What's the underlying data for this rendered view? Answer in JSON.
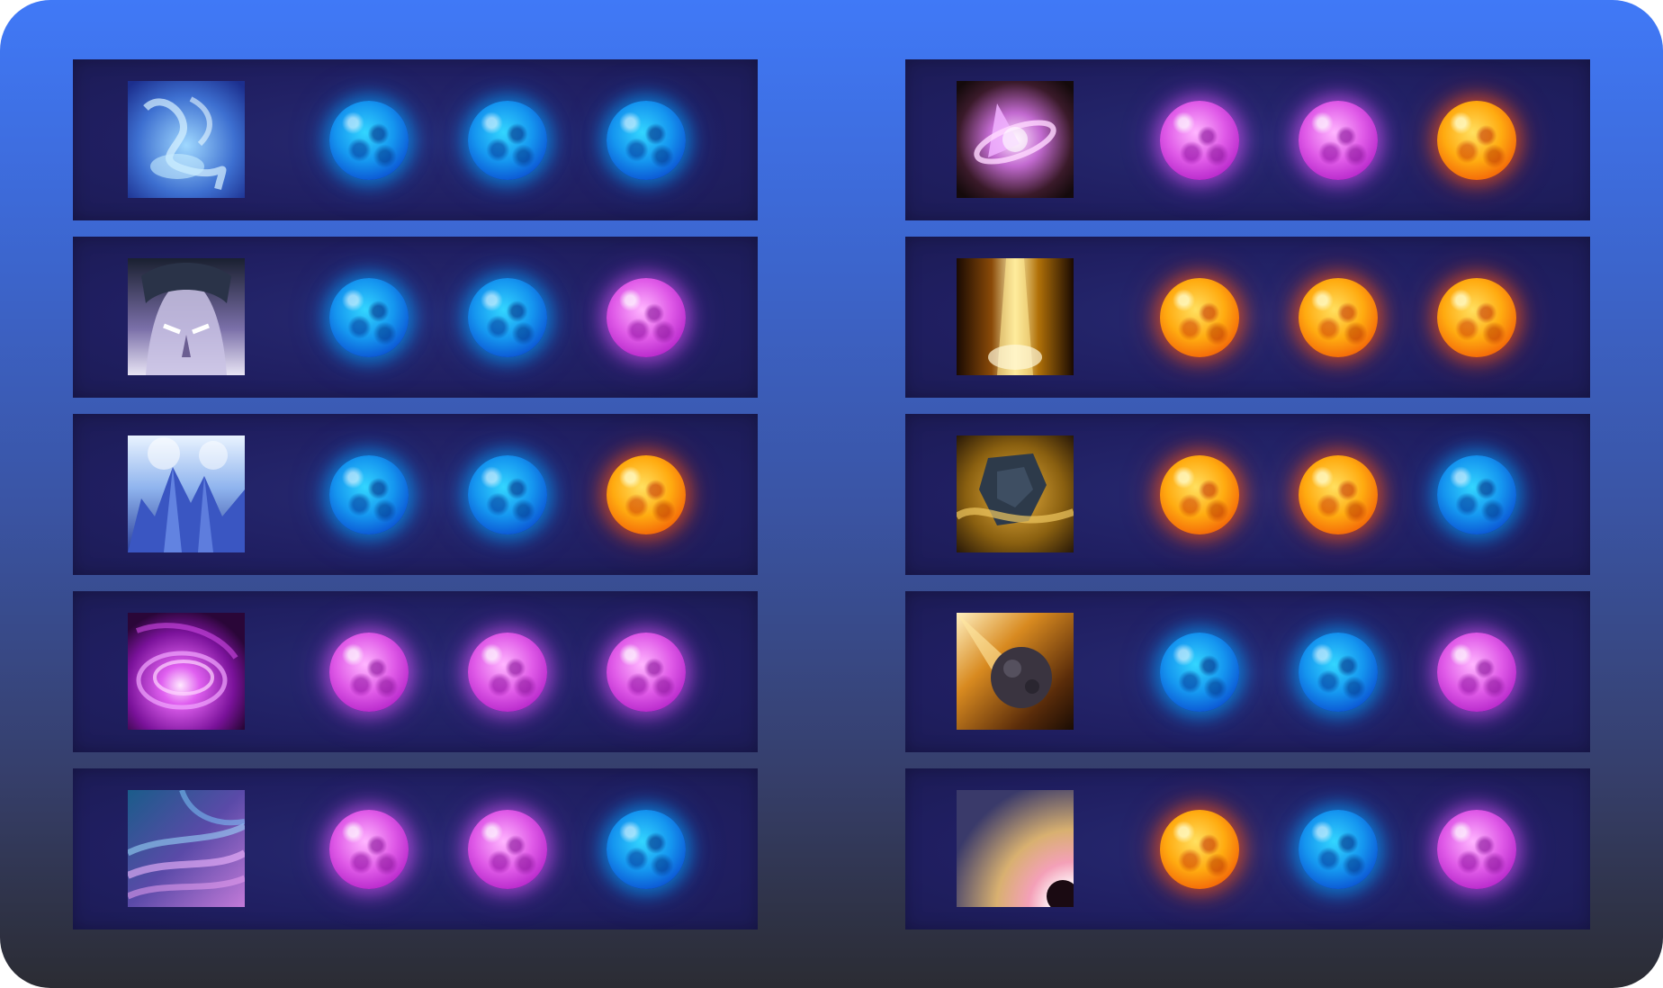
{
  "orb_types": {
    "quas": {
      "color": "#1596f0"
    },
    "wex": {
      "color": "#e05be8"
    },
    "exort": {
      "color": "#ffab10"
    }
  },
  "spells": [
    {
      "icon": "cold-snap-icon",
      "orbs": [
        "quas",
        "quas",
        "quas"
      ]
    },
    {
      "icon": "ghost-walk-icon",
      "orbs": [
        "quas",
        "quas",
        "wex"
      ]
    },
    {
      "icon": "ice-wall-icon",
      "orbs": [
        "quas",
        "quas",
        "exort"
      ]
    },
    {
      "icon": "emp-icon",
      "orbs": [
        "wex",
        "wex",
        "wex"
      ]
    },
    {
      "icon": "tornado-icon",
      "orbs": [
        "wex",
        "wex",
        "quas"
      ]
    },
    {
      "icon": "alacrity-icon",
      "orbs": [
        "wex",
        "wex",
        "exort"
      ]
    },
    {
      "icon": "sun-strike-icon",
      "orbs": [
        "exort",
        "exort",
        "exort"
      ]
    },
    {
      "icon": "forge-spirit-icon",
      "orbs": [
        "exort",
        "exort",
        "quas"
      ]
    },
    {
      "icon": "chaos-meteor-icon",
      "orbs": [
        "quas",
        "quas",
        "wex"
      ]
    },
    {
      "icon": "deafening-blast-icon",
      "orbs": [
        "exort",
        "quas",
        "wex"
      ]
    }
  ]
}
